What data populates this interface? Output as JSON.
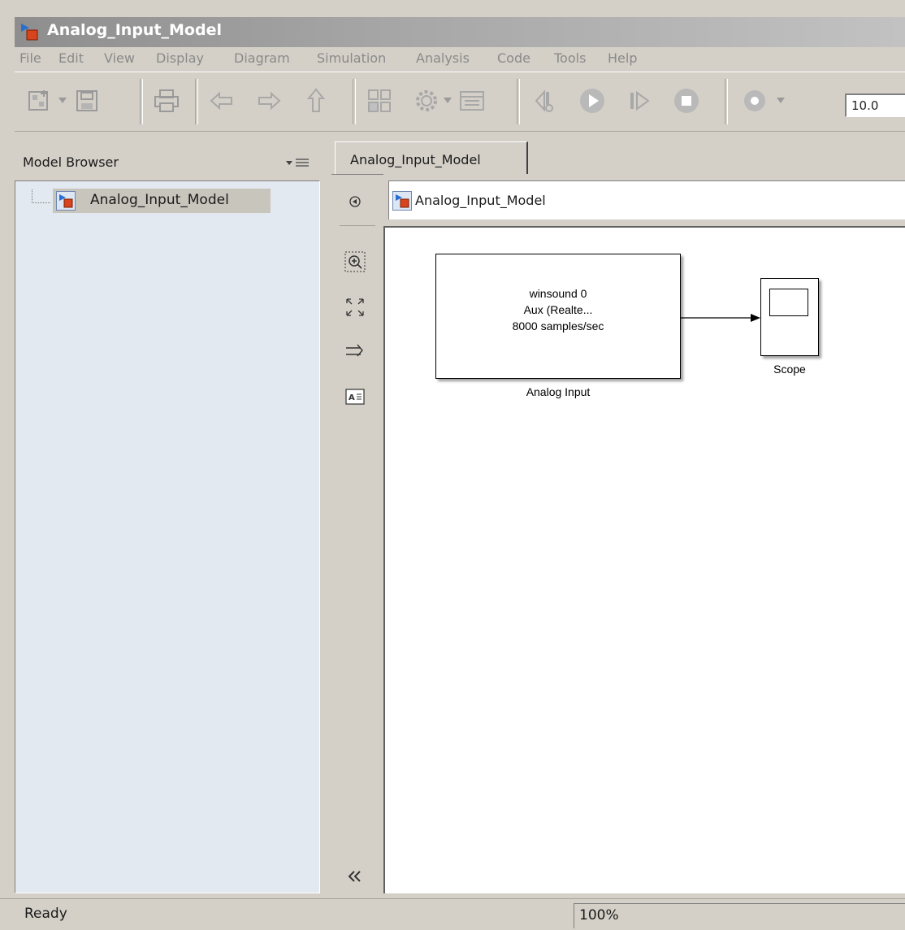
{
  "window": {
    "title": "Analog_Input_Model"
  },
  "menu": [
    "File",
    "Edit",
    "View",
    "Display",
    "Diagram",
    "Simulation",
    "Analysis",
    "Code",
    "Tools",
    "Help"
  ],
  "toolbar": {
    "stop_time": "10.0"
  },
  "model_browser": {
    "title": "Model Browser",
    "items": [
      {
        "label": "Analog_Input_Model"
      }
    ]
  },
  "editor": {
    "tab_label": "Analog_Input_Model",
    "breadcrumb": "Analog_Input_Model"
  },
  "diagram": {
    "analog_input": {
      "lines": [
        "winsound 0",
        "Aux (Realte...",
        "8000 samples/sec"
      ],
      "caption": "Analog Input"
    },
    "scope": {
      "caption": "Scope"
    }
  },
  "status": {
    "text": "Ready",
    "zoom": "100%"
  },
  "icons": {
    "model": "simulink-model-icon",
    "new_model": "new-model-icon",
    "save": "save-icon",
    "print": "print-icon",
    "back": "back-arrow-icon",
    "forward": "forward-arrow-icon",
    "up": "up-arrow-icon",
    "library": "library-browser-icon",
    "config": "gear-icon",
    "explorer": "model-explorer-icon",
    "step_back": "step-back-icon",
    "run": "run-icon",
    "step_forward": "step-forward-icon",
    "stop": "stop-icon",
    "record": "record-icon"
  },
  "colors": {
    "window_bg": "#d4d0c8",
    "tree_bg": "#e3e9f0",
    "title_gradient": "#8e8e8e"
  }
}
